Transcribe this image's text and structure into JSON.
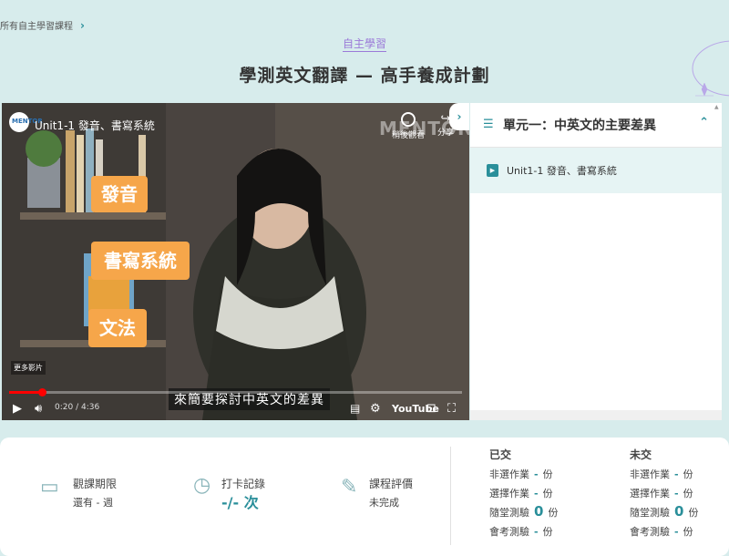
{
  "breadcrumb": {
    "label": "所有自主學習課程"
  },
  "category": "自主學習",
  "page_title": "學測英文翻譯 — 高手養成計劃",
  "video": {
    "title": "Unit1-1 發音、書寫系統",
    "logo_text": "MENTOR",
    "watch_later": "稍後觀看",
    "share": "分享",
    "watermark": "MENTOR",
    "tags": [
      "發音",
      "書寫系統",
      "文法"
    ],
    "more_videos": "更多影片",
    "subtitle": "來簡要探討中英文的差異",
    "time": "0:20 / 4:36",
    "progress": 0.072,
    "platform": "YouTube"
  },
  "panel": {
    "unit_title": "單元一：中英文的主要差異",
    "lessons": [
      {
        "label": "Unit1-1 發音、書寫系統"
      }
    ]
  },
  "stats": {
    "viewing_period": {
      "label": "觀課期限",
      "value": "還有 - 週"
    },
    "checkin": {
      "label": "打卡記錄",
      "value": "-/- 次"
    },
    "rating": {
      "label": "課程評價",
      "value": "未完成"
    },
    "submitted": {
      "header": "已交",
      "rows": [
        {
          "label": "非選作業",
          "value": "-",
          "unit": "份"
        },
        {
          "label": "選擇作業",
          "value": "-",
          "unit": "份"
        },
        {
          "label": "隨堂測驗",
          "value": "0",
          "unit": "份"
        },
        {
          "label": "會考測驗",
          "value": "-",
          "unit": "份"
        }
      ]
    },
    "not_submitted": {
      "header": "未交",
      "rows": [
        {
          "label": "非選作業",
          "value": "-",
          "unit": "份"
        },
        {
          "label": "選擇作業",
          "value": "-",
          "unit": "份"
        },
        {
          "label": "隨堂測驗",
          "value": "0",
          "unit": "份"
        },
        {
          "label": "會考測驗",
          "value": "-",
          "unit": "份"
        }
      ]
    }
  },
  "colors": {
    "accent": "#2a8f9a",
    "category": "#9b7ad8",
    "tag": "#f6a64a",
    "background": "#d7ecec"
  }
}
